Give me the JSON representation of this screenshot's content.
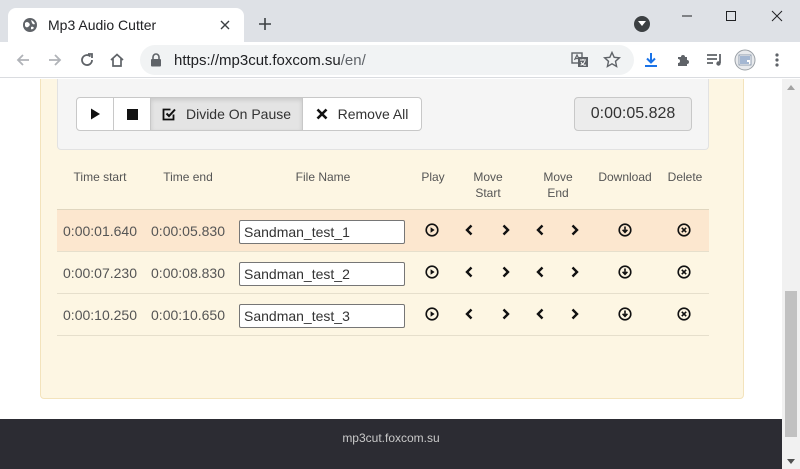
{
  "browser": {
    "tab_title": "Mp3 Audio Cutter",
    "url_host": "https://mp3cut.foxcom.su",
    "url_path": "/en/"
  },
  "controls": {
    "divide_on_pause_label": "Divide On Pause",
    "remove_all_label": "Remove All",
    "timer": "0:00:05.828"
  },
  "table": {
    "headers": {
      "time_start": "Time start",
      "time_end": "Time end",
      "file_name": "File Name",
      "play": "Play",
      "move_start_1": "Move",
      "move_start_2": "Start",
      "move_end_1": "Move",
      "move_end_2": "End",
      "download": "Download",
      "delete": "Delete"
    },
    "rows": [
      {
        "time_start": "0:00:01.640",
        "time_end": "0:00:05.830",
        "file_name": "Sandman_test_1"
      },
      {
        "time_start": "0:00:07.230",
        "time_end": "0:00:08.830",
        "file_name": "Sandman_test_2"
      },
      {
        "time_start": "0:00:10.250",
        "time_end": "0:00:10.650",
        "file_name": "Sandman_test_3"
      }
    ],
    "highlighted_row": 0
  },
  "footer": {
    "text": "mp3cut.foxcom.su"
  },
  "colors": {
    "panel_bg": "#fdf6e3",
    "row_highlight": "#fce7cf",
    "footer_bg": "#2c2c33",
    "download_arrow": "#1a73e8"
  }
}
